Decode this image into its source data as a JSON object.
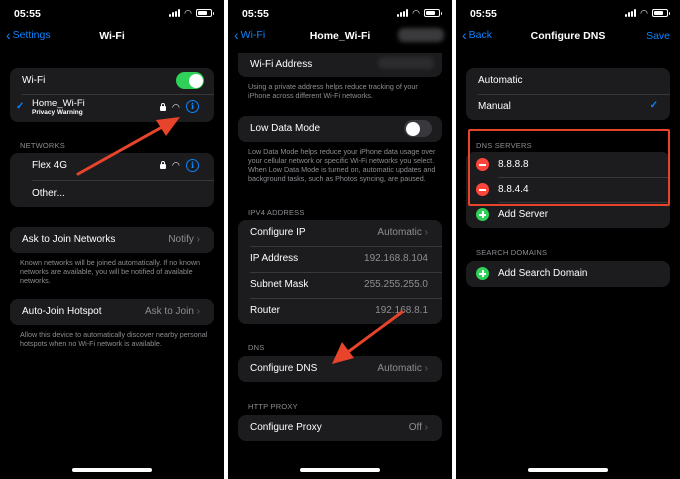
{
  "panel1": {
    "time": "05:55",
    "back_label": "Settings",
    "title": "Wi-Fi",
    "wifi_label": "Wi-Fi",
    "wifi_on": true,
    "current_network": "Home_Wi-Fi",
    "privacy_warning": "Privacy Warning",
    "networks_header": "NETWORKS",
    "networks": [
      "Flex 4G",
      "Other..."
    ],
    "ask_to_join_label": "Ask to Join Networks",
    "ask_to_join_value": "Notify",
    "ask_to_join_note": "Known networks will be joined automatically. If no known networks are available, you will be notified of available networks.",
    "auto_join_label": "Auto-Join Hotspot",
    "auto_join_value": "Ask to Join",
    "auto_join_note": "Allow this device to automatically discover nearby personal hotspots when no Wi-Fi network is available."
  },
  "panel2": {
    "time": "05:55",
    "back_label": "Wi-Fi",
    "title": "Home_Wi-Fi",
    "wifi_address_label": "Wi-Fi Address",
    "wifi_address_note": "Using a private address helps reduce tracking of your iPhone across different Wi-Fi networks.",
    "low_data_label": "Low Data Mode",
    "low_data_on": false,
    "low_data_note": "Low Data Mode helps reduce your iPhone data usage over your cellular network or specific Wi-Fi networks you select. When Low Data Mode is turned on, automatic updates and background tasks, such as Photos syncing, are paused.",
    "ipv4_header": "IPV4 ADDRESS",
    "configure_ip_label": "Configure IP",
    "configure_ip_value": "Automatic",
    "ip_address_label": "IP Address",
    "ip_address_value": "192.168.8.104",
    "subnet_label": "Subnet Mask",
    "subnet_value": "255.255.255.0",
    "router_label": "Router",
    "router_value": "192.168.8.1",
    "dns_header": "DNS",
    "configure_dns_label": "Configure DNS",
    "configure_dns_value": "Automatic",
    "proxy_header": "HTTP PROXY",
    "configure_proxy_label": "Configure Proxy",
    "configure_proxy_value": "Off"
  },
  "panel3": {
    "time": "05:55",
    "back_label": "Back",
    "title": "Configure DNS",
    "save_label": "Save",
    "automatic_label": "Automatic",
    "manual_label": "Manual",
    "dns_servers_header": "DNS SERVERS",
    "dns_servers": [
      "8.8.8.8",
      "8.8.4.4"
    ],
    "add_server_label": "Add Server",
    "search_domains_header": "SEARCH DOMAINS",
    "add_search_domain_label": "Add Search Domain"
  },
  "colors": {
    "accent": "#0a84ff",
    "toggle_on": "#30d158",
    "delete": "#ff453a",
    "annotation": "#e8432b"
  }
}
